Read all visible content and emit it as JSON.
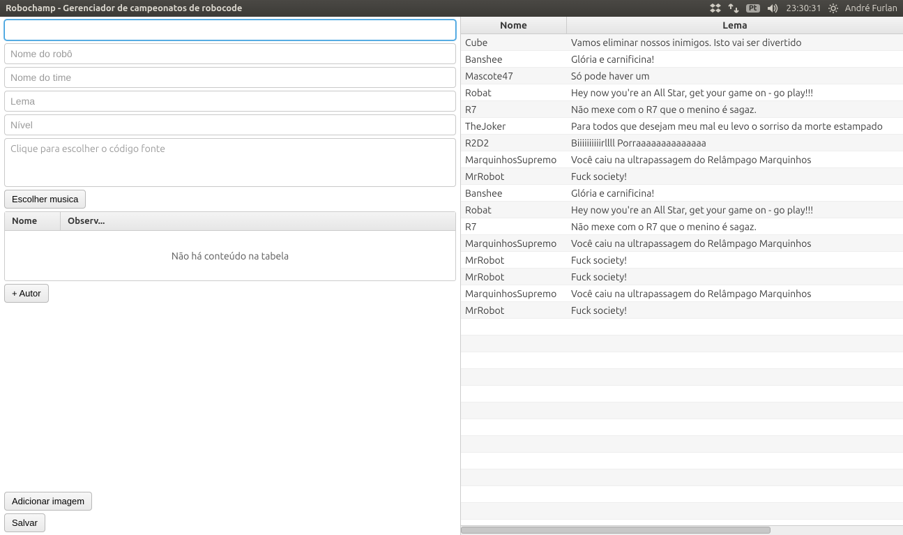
{
  "menubar": {
    "title": "Robochamp - Gerenciador de campeonatos de robocode",
    "lang_badge": "Pt",
    "time": "23:30:31",
    "user": "André Furlan"
  },
  "form": {
    "field0_placeholder": "",
    "robot_name_placeholder": "Nome do robô",
    "team_name_placeholder": "Nome do time",
    "lema_placeholder": "Lema",
    "nivel_placeholder": "Nível",
    "code_placeholder": "Clique para escolher o código fonte",
    "choose_music_label": "Escolher musica",
    "table": {
      "col_name": "Nome",
      "col_obs": "Observ...",
      "empty_msg": "Não há conteúdo na tabela"
    },
    "add_author_label": "+ Autor",
    "add_image_label": "Adicionar imagem",
    "save_label": "Salvar"
  },
  "right_table": {
    "col_name": "Nome",
    "col_lema": "Lema",
    "rows": [
      {
        "nome": "Cube",
        "lema": "Vamos eliminar nossos inimigos. Isto vai ser divertido"
      },
      {
        "nome": "Banshee",
        "lema": "Glória e carnificina!"
      },
      {
        "nome": "Mascote47",
        "lema": "Só pode haver um"
      },
      {
        "nome": "Robat",
        "lema": "Hey now you're an All Star, get your game on - go play!!!"
      },
      {
        "nome": "R7",
        "lema": "Não mexe com o R7 que o menino é sagaz."
      },
      {
        "nome": "TheJoker",
        "lema": "Para todos que desejam meu mal eu levo o sorriso da morte estampado"
      },
      {
        "nome": "R2D2",
        "lema": "Biiiiiiiiiirllll Porraaaaaaaaaaaaaa"
      },
      {
        "nome": "MarquinhosSupremo",
        "lema": "Você caiu na ultrapassagem do Relâmpago Marquinhos"
      },
      {
        "nome": "MrRobot",
        "lema": "Fuck society!"
      },
      {
        "nome": "Banshee",
        "lema": "Glória e carnificina!"
      },
      {
        "nome": "Robat",
        "lema": "Hey now you're an All Star, get your game on - go play!!!"
      },
      {
        "nome": "R7",
        "lema": "Não mexe com o R7 que o menino é sagaz."
      },
      {
        "nome": "MarquinhosSupremo",
        "lema": "Você caiu na ultrapassagem do Relâmpago Marquinhos"
      },
      {
        "nome": "MrRobot",
        "lema": "Fuck society!"
      },
      {
        "nome": "MrRobot",
        "lema": "Fuck society!"
      },
      {
        "nome": "MarquinhosSupremo",
        "lema": "Você caiu na ultrapassagem do Relâmpago Marquinhos"
      },
      {
        "nome": "MrRobot",
        "lema": "Fuck society!"
      }
    ],
    "empty_trailing_rows": 12
  }
}
